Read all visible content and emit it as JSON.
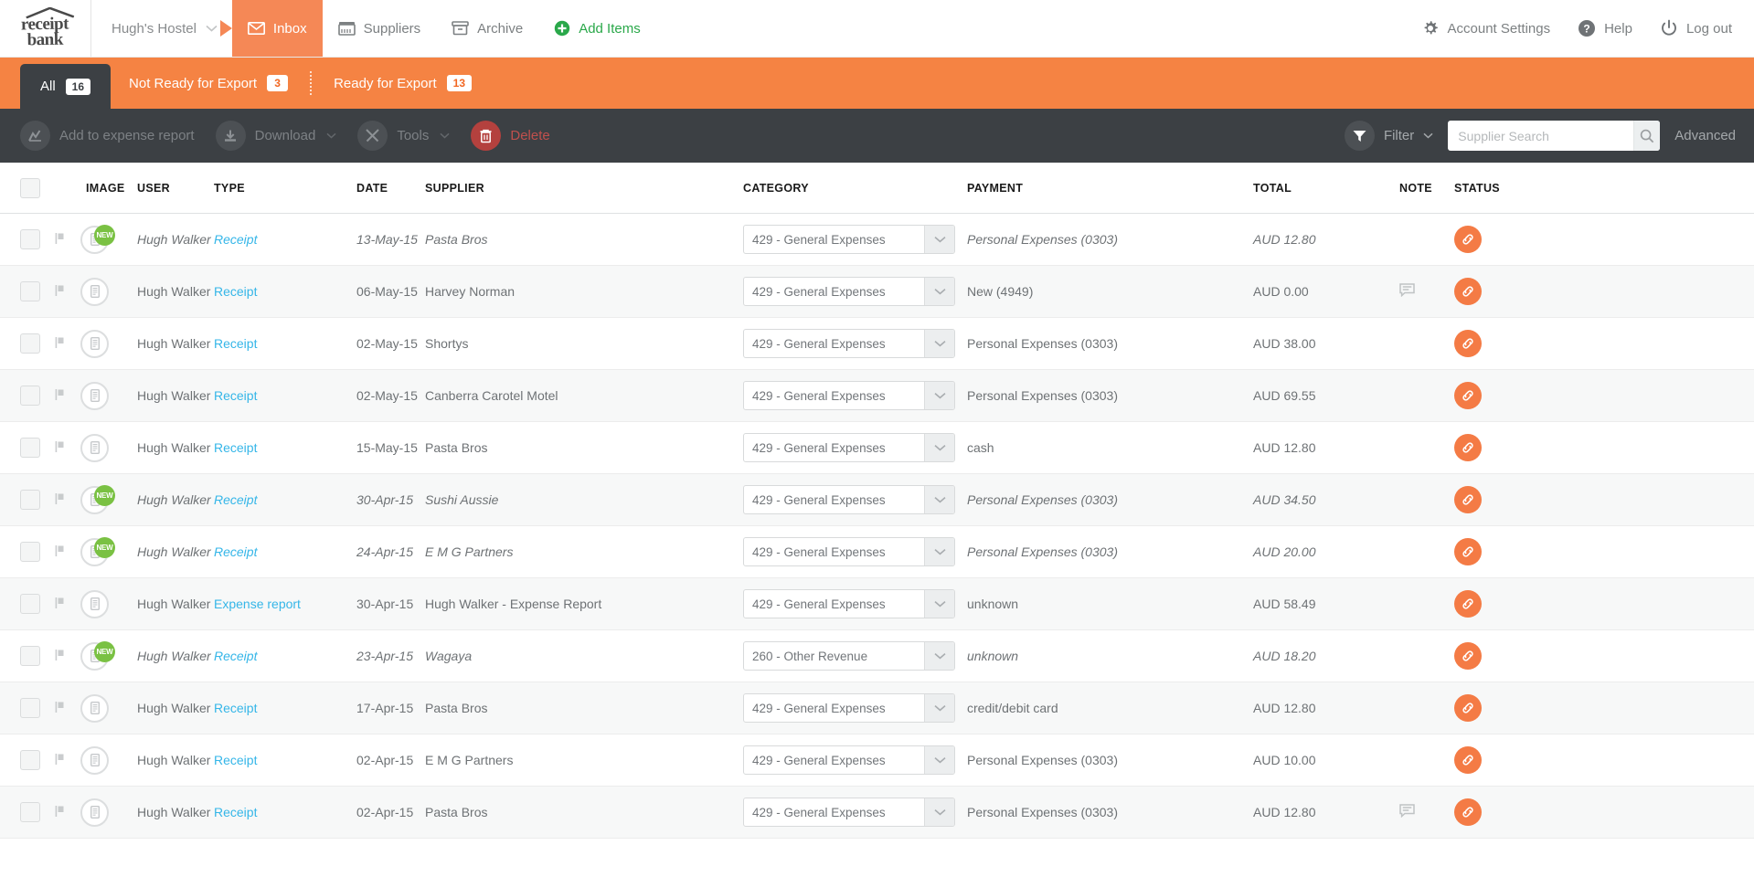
{
  "brand": {
    "logo_line1": "receipt",
    "logo_line2": "bank",
    "accent_orange": "#f58343",
    "dark": "#3c4044",
    "link_blue": "#35b6e8",
    "green": "#7ac143",
    "red": "#b4413e"
  },
  "topnav": {
    "org": "Hugh's Hostel",
    "items": [
      {
        "label": "Inbox",
        "icon": "envelope-icon",
        "active": true
      },
      {
        "label": "Suppliers",
        "icon": "store-icon",
        "active": false
      },
      {
        "label": "Archive",
        "icon": "archive-box-icon",
        "active": false
      },
      {
        "label": "Add Items",
        "icon": "plus-circle-icon",
        "active": false
      }
    ],
    "right": [
      {
        "label": "Account Settings",
        "icon": "gear-icon"
      },
      {
        "label": "Help",
        "icon": "question-circle-icon"
      },
      {
        "label": "Log out",
        "icon": "power-icon"
      }
    ]
  },
  "tabs": [
    {
      "label": "All",
      "count": "16",
      "active": true
    },
    {
      "label": "Not Ready for Export",
      "count": "3",
      "active": false
    },
    {
      "label": "Ready for Export",
      "count": "13",
      "active": false
    }
  ],
  "toolbar": {
    "add_to_expense_report": "Add to expense report",
    "download": "Download",
    "tools": "Tools",
    "delete": "Delete",
    "filter": "Filter",
    "search_placeholder": "Supplier Search",
    "search_value": "",
    "advanced": "Advanced"
  },
  "table": {
    "headers": {
      "image": "IMAGE",
      "user": "USER",
      "type": "TYPE",
      "date": "DATE",
      "supplier": "SUPPLIER",
      "category": "CATEGORY",
      "payment": "PAYMENT",
      "total": "TOTAL",
      "note": "NOTE",
      "status": "STATUS"
    },
    "rows": [
      {
        "new": true,
        "user": "Hugh Walker",
        "type": "Receipt",
        "date": "13-May-15",
        "supplier": "Pasta Bros",
        "category": "429 - General Expenses",
        "payment": "Personal Expenses (0303)",
        "total": "AUD 12.80",
        "note": false
      },
      {
        "new": false,
        "user": "Hugh Walker",
        "type": "Receipt",
        "date": "06-May-15",
        "supplier": "Harvey Norman",
        "category": "429 - General Expenses",
        "payment": "New (4949)",
        "total": "AUD 0.00",
        "note": true
      },
      {
        "new": false,
        "user": "Hugh Walker",
        "type": "Receipt",
        "date": "02-May-15",
        "supplier": "Shortys",
        "category": "429 - General Expenses",
        "payment": "Personal Expenses (0303)",
        "total": "AUD 38.00",
        "note": false
      },
      {
        "new": false,
        "user": "Hugh Walker",
        "type": "Receipt",
        "date": "02-May-15",
        "supplier": "Canberra Carotel Motel",
        "category": "429 - General Expenses",
        "payment": "Personal Expenses (0303)",
        "total": "AUD 69.55",
        "note": false
      },
      {
        "new": false,
        "user": "Hugh Walker",
        "type": "Receipt",
        "date": "15-May-15",
        "supplier": "Pasta Bros",
        "category": "429 - General Expenses",
        "payment": "cash",
        "total": "AUD 12.80",
        "note": false
      },
      {
        "new": true,
        "user": "Hugh Walker",
        "type": "Receipt",
        "date": "30-Apr-15",
        "supplier": "Sushi Aussie",
        "category": "429 - General Expenses",
        "payment": "Personal Expenses (0303)",
        "total": "AUD 34.50",
        "note": false
      },
      {
        "new": true,
        "user": "Hugh Walker",
        "type": "Receipt",
        "date": "24-Apr-15",
        "supplier": "E M G Partners",
        "category": "429 - General Expenses",
        "payment": "Personal Expenses (0303)",
        "total": "AUD 20.00",
        "note": false
      },
      {
        "new": false,
        "user": "Hugh Walker",
        "type": "Expense report",
        "date": "30-Apr-15",
        "supplier": "Hugh Walker - Expense Report",
        "category": "429 - General Expenses",
        "payment": "unknown",
        "total": "AUD 58.49",
        "note": false
      },
      {
        "new": true,
        "user": "Hugh Walker",
        "type": "Receipt",
        "date": "23-Apr-15",
        "supplier": "Wagaya",
        "category": "260 - Other Revenue",
        "payment": "unknown",
        "total": "AUD 18.20",
        "note": false
      },
      {
        "new": false,
        "user": "Hugh Walker",
        "type": "Receipt",
        "date": "17-Apr-15",
        "supplier": "Pasta Bros",
        "category": "429 - General Expenses",
        "payment": "credit/debit card",
        "total": "AUD 12.80",
        "note": false
      },
      {
        "new": false,
        "user": "Hugh Walker",
        "type": "Receipt",
        "date": "02-Apr-15",
        "supplier": "E M G Partners",
        "category": "429 - General Expenses",
        "payment": "Personal Expenses (0303)",
        "total": "AUD 10.00",
        "note": false
      },
      {
        "new": false,
        "user": "Hugh Walker",
        "type": "Receipt",
        "date": "02-Apr-15",
        "supplier": "Pasta Bros",
        "category": "429 - General Expenses",
        "payment": "Personal Expenses (0303)",
        "total": "AUD 12.80",
        "note": true
      }
    ]
  }
}
